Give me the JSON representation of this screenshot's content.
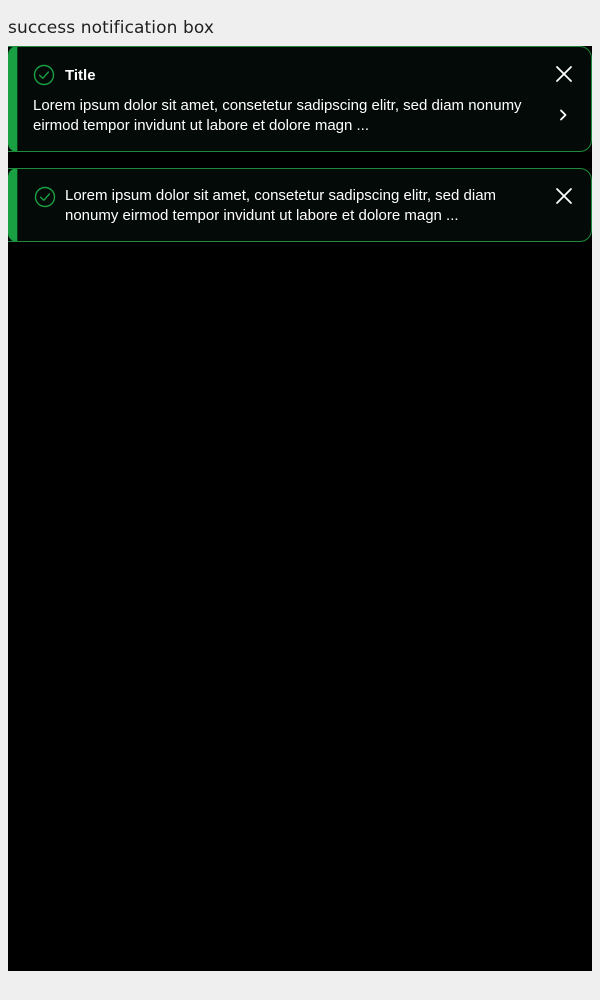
{
  "page": {
    "heading": "success notification box"
  },
  "notifications": [
    {
      "title": "Title",
      "body": "Lorem ipsum dolor sit amet, consetetur sadipscing elitr, sed diam nonumy eirmod tempor invidunt ut labore et dolore magn ...",
      "icon": "check-circle-icon",
      "actions": [
        "close-icon",
        "chevron-right-icon"
      ]
    },
    {
      "body": "Lorem ipsum dolor sit amet, consetetur sadipscing elitr, sed diam nonumy eirmod tempor invidunt ut labore et dolore magn ...",
      "icon": "check-circle-icon",
      "actions": [
        "close-icon"
      ]
    }
  ],
  "colors": {
    "page_background": "#f0efef",
    "canvas_background": "#000000",
    "success_accent": "#19a043",
    "notification_border": "#1f8a3c",
    "notification_background": "#040a07",
    "text": "#ffffff"
  }
}
